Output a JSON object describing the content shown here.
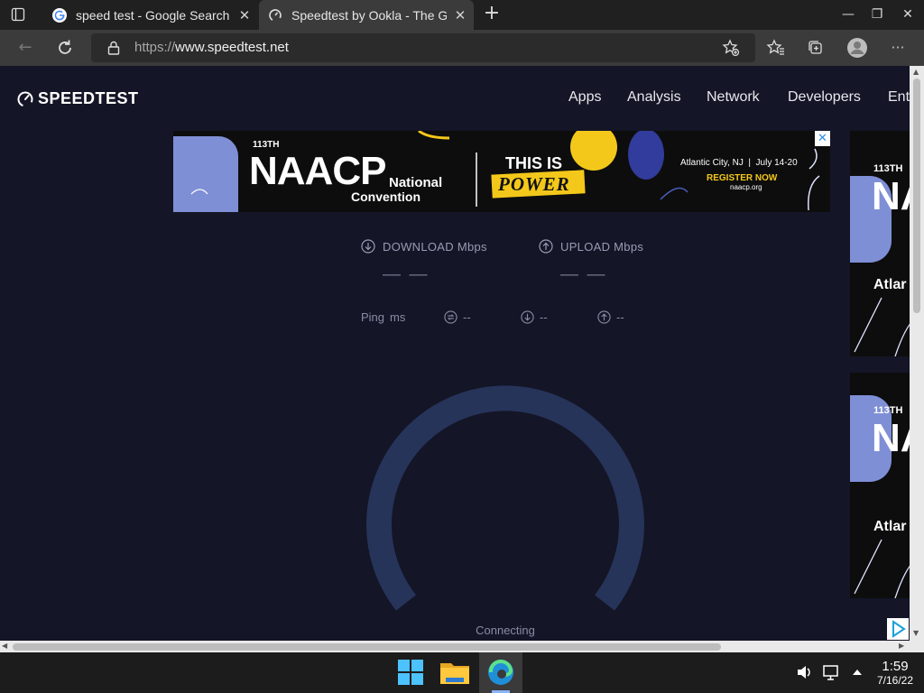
{
  "browser": {
    "tabs": [
      {
        "title": "speed test - Google Search"
      },
      {
        "title": "Speedtest by Ookla - The Global Broadband Speed Test"
      }
    ],
    "url_protocol": "https://",
    "url_host": "www.speedtest.net"
  },
  "site": {
    "logo_text": "SPEEDTEST",
    "nav": [
      "Apps",
      "Analysis",
      "Network",
      "Developers",
      "Ent"
    ]
  },
  "ad": {
    "edition": "113TH",
    "org": "NAACP",
    "nat": "National",
    "conv": "Convention",
    "tag1": "THIS IS",
    "tag2": "POWER",
    "location": "Atlantic City, NJ  |  July 14-20",
    "cta": "REGISTER NOW",
    "site": "naacp.org",
    "side_edition": "113TH",
    "side_partial": "Atlar"
  },
  "metrics": {
    "download_label": "DOWNLOAD Mbps",
    "upload_label": "UPLOAD Mbps",
    "download_value": "— —",
    "upload_value": "— —",
    "ping_label": "Ping",
    "ping_unit": "ms",
    "jitter_value": "--",
    "ping_down_value": "--",
    "ping_up_value": "--"
  },
  "status": {
    "connecting": "Connecting"
  },
  "taskbar": {
    "time": "1:59",
    "date": "7/16/22"
  },
  "colors": {
    "page_bg": "#141526",
    "gauge": "#26345a",
    "ad_yellow": "#f4c81a",
    "ad_blue": "#7f8fd6"
  }
}
